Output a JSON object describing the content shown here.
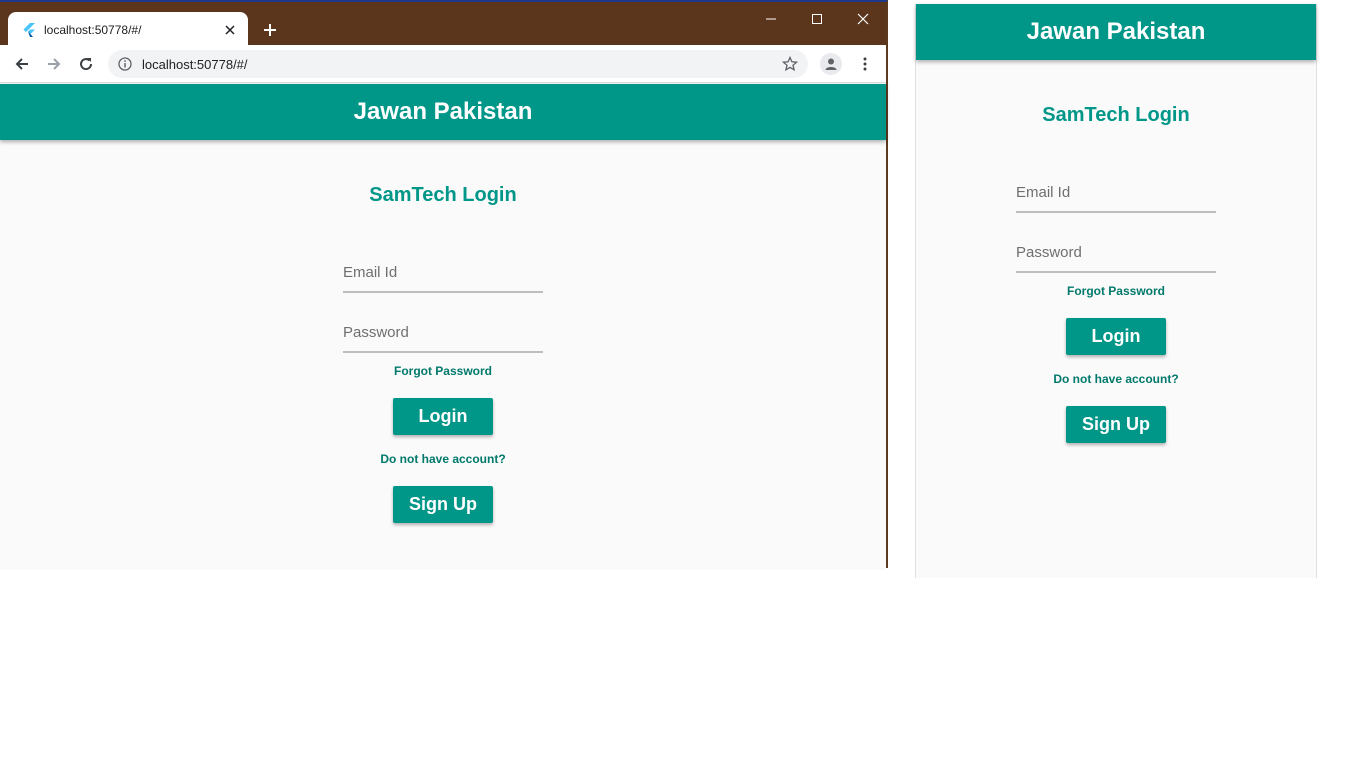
{
  "browser": {
    "tab_title": "localhost:50778/#/",
    "url": "localhost:50778/#/",
    "icons": {
      "favicon": "flutter-icon",
      "tab_close": "close-icon",
      "new_tab": "plus-icon",
      "minimize": "minimize-icon",
      "maximize": "maximize-icon",
      "close_window": "close-icon",
      "back": "arrow-left-icon",
      "forward": "arrow-right-icon",
      "reload": "reload-icon",
      "site_info": "info-icon",
      "bookmark": "star-icon",
      "profile": "person-icon",
      "menu": "more-vert-icon"
    },
    "colors": {
      "titlebar": "#5c361c",
      "tab": "#ffffff"
    }
  },
  "app": {
    "appbar_title": "Jawan Pakistan",
    "login_title": "SamTech Login",
    "email_placeholder": "Email Id",
    "password_placeholder": "Password",
    "forgot_password": "Forgot Password",
    "login_button": "Login",
    "no_account": "Do not have account?",
    "signup_button": "Sign Up",
    "colors": {
      "primary": "#009688",
      "link": "#00796b",
      "background": "#fafafa"
    }
  }
}
